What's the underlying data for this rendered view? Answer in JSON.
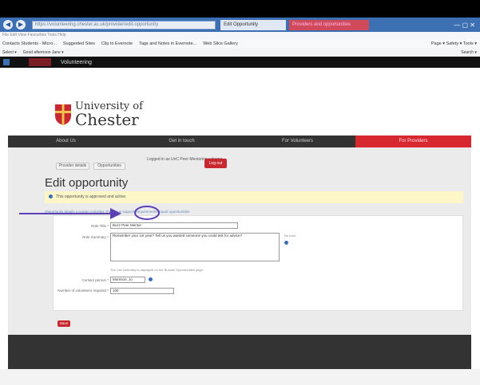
{
  "browser": {
    "address": "https://volunteering.chester.ac.uk/provider/edit-opportunity",
    "tab_active": "Edit Opportunity",
    "tab_other": "Providers and opportunities",
    "menu": "File  Edit  View  Favourites  Tools  Help",
    "favourites": [
      "Contacts Students - Micro...",
      "Suggested Sites",
      "Clip to Evernote",
      "Tags and Notes in Evernote...",
      "Web Slice Gallery"
    ],
    "fav_right": "Page ▾  Safety ▾  Tools ▾",
    "cmd_left": [
      "Select ▾",
      "Good afternoon Jane ▾"
    ],
    "cmd_right": "Search ▾"
  },
  "site_bar": {
    "logo_text": "University of Chester",
    "section": "Volunteering"
  },
  "logo": {
    "line1": "University of",
    "line2": "Chester"
  },
  "mainnav": [
    "About Us",
    "Get in touch",
    "For Volunteers",
    "For Providers"
  ],
  "content": {
    "btn_provider_details": "Provider details",
    "btn_opportunities": "Opportunities",
    "logged_in": "Logged in as UoC Peer Mentoring scheme",
    "btn_logout": "Log out",
    "heading": "Edit opportunity",
    "notice": "This opportunity is approved and active.",
    "tabs": "Opportunity details   Location   Activities   Training & support   Requirements   Equal opportunities",
    "form": {
      "role_title_label": "Role Title *",
      "role_title_value": "Buzz Peer Mentor",
      "summary_label": "Role Summary *",
      "summary_value": "Remember your 1st year? Tell us you wanted someone you could ask for advice?",
      "summary_hint": "The role summary is displayed on the Browse Opportunities page.",
      "summary_side": "No bold",
      "contact_label": "Contact person *",
      "contact_value": "Morrison, Jo",
      "volunteers_label": "Number of volunteers required *",
      "volunteers_value": "100"
    },
    "btn_save": "Save"
  },
  "colors": {
    "brand_red": "#c8282f",
    "nav_dark": "#333333",
    "browser_blue": "#3d6fb3",
    "annotation_purple": "#5b3fb5"
  }
}
